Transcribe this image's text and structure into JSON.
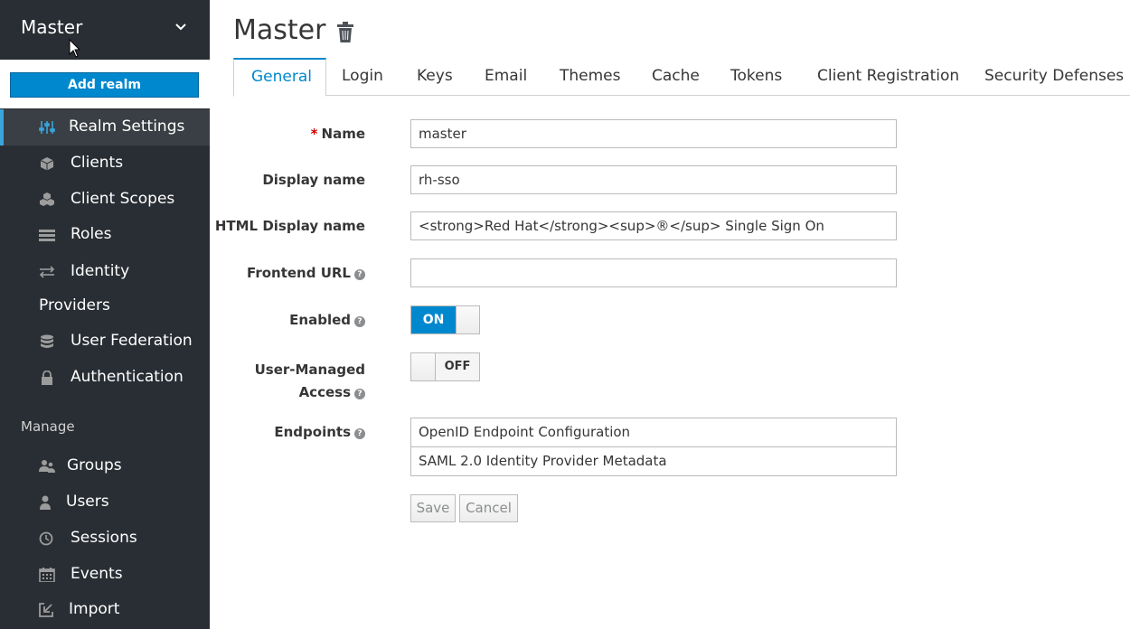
{
  "realm": {
    "name": "Master",
    "add_button": "Add realm"
  },
  "sidebar": {
    "items": [
      {
        "label": "Realm Settings",
        "icon": "sliders-icon"
      },
      {
        "label": "Clients",
        "icon": "cube-icon"
      },
      {
        "label": "Client Scopes",
        "icon": "cubes-icon"
      },
      {
        "label": "Roles",
        "icon": "list-icon"
      },
      {
        "label": "Identity",
        "label2": "Providers",
        "icon": "exchange-icon"
      },
      {
        "label": "User Federation",
        "icon": "database-icon"
      },
      {
        "label": "Authentication",
        "icon": "lock-icon"
      }
    ],
    "manage_label": "Manage",
    "manage_items": [
      {
        "label": "Groups",
        "icon": "users-icon"
      },
      {
        "label": "Users",
        "icon": "user-icon"
      },
      {
        "label": "Sessions",
        "icon": "clock-icon"
      },
      {
        "label": "Events",
        "icon": "calendar-icon"
      },
      {
        "label": "Import",
        "icon": "import-icon"
      }
    ]
  },
  "page": {
    "title": "Master"
  },
  "tabs": [
    {
      "label": "General"
    },
    {
      "label": "Login"
    },
    {
      "label": "Keys"
    },
    {
      "label": "Email"
    },
    {
      "label": "Themes"
    },
    {
      "label": "Cache"
    },
    {
      "label": "Tokens"
    },
    {
      "label": "Client Registration"
    },
    {
      "label": "Security Defenses"
    }
  ],
  "form": {
    "name_label": "Name",
    "name_value": "master",
    "display_name_label": "Display name",
    "display_name_value": "rh-sso",
    "html_display_name_label": "HTML Display name",
    "html_display_name_value": "<strong>Red Hat</strong><sup>®</sup> Single Sign On",
    "frontend_url_label": "Frontend URL",
    "frontend_url_value": "",
    "enabled_label": "Enabled",
    "enabled_state": "ON",
    "user_managed_label_line1": "User-Managed",
    "user_managed_label_line2": "Access",
    "user_managed_state": "OFF",
    "endpoints_label": "Endpoints",
    "endpoints": [
      "OpenID Endpoint Configuration",
      "SAML 2.0 Identity Provider Metadata"
    ],
    "save_label": "Save",
    "cancel_label": "Cancel",
    "help_glyph": "?"
  },
  "colors": {
    "sidebar_bg": "#292e34",
    "active_item_bg": "#393f44",
    "accent": "#0088ce",
    "active_border": "#39a5dc"
  }
}
